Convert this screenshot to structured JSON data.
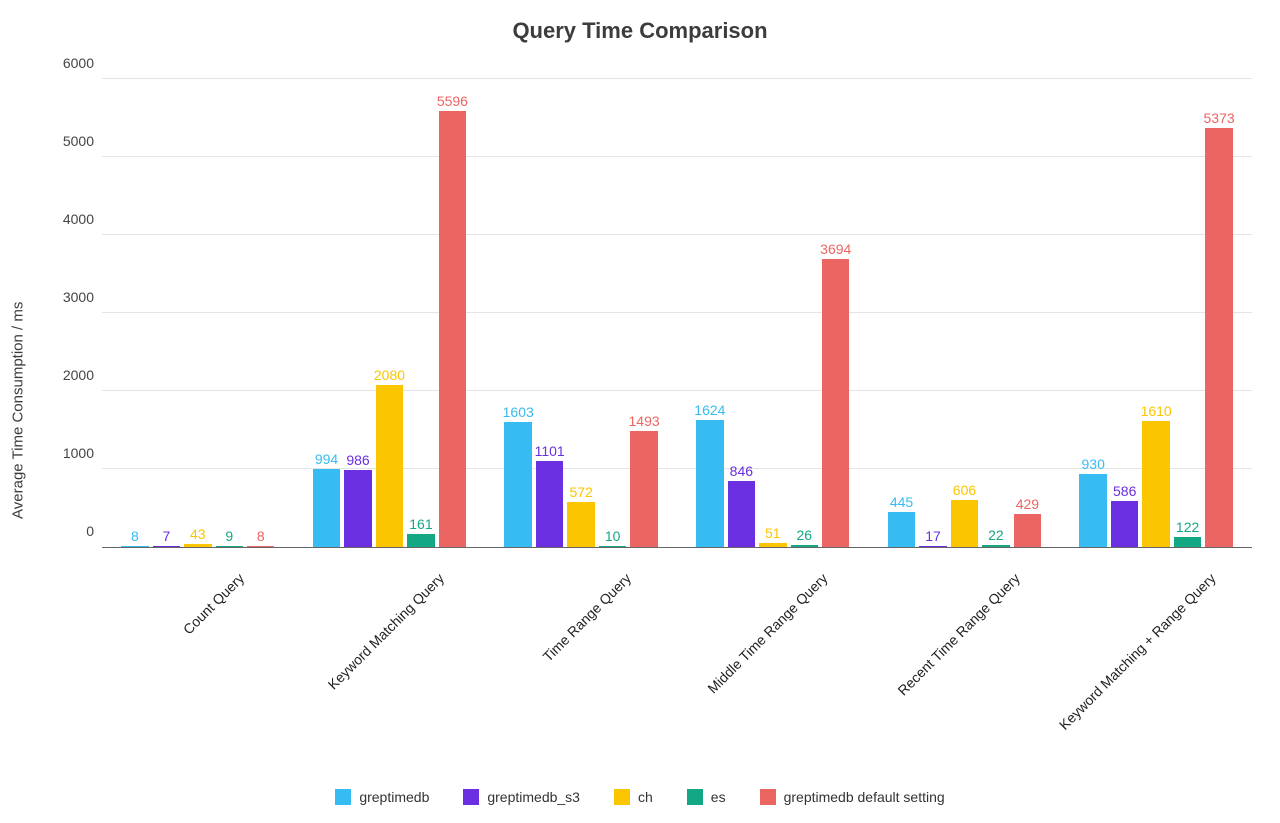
{
  "chart_data": {
    "type": "bar",
    "title": "Query Time Comparison",
    "xlabel": "",
    "ylabel": "Average Time Consumption / ms",
    "ylim": [
      0,
      6000
    ],
    "yticks": [
      0,
      1000,
      2000,
      3000,
      4000,
      5000,
      6000
    ],
    "categories": [
      "Count Query",
      "Keyword Matching Query",
      "Time Range Query",
      "Middle Time Range Query",
      "Recent Time Range Query",
      "Keyword Matching + Range Query"
    ],
    "series": [
      {
        "name": "greptimedb",
        "color": "#36bcf2",
        "values": [
          8,
          994,
          1603,
          1624,
          445,
          930
        ]
      },
      {
        "name": "greptimedb_s3",
        "color": "#6a2fe0",
        "values": [
          7,
          986,
          1101,
          846,
          17,
          586
        ]
      },
      {
        "name": "ch",
        "color": "#fbc500",
        "values": [
          43,
          2080,
          572,
          51,
          606,
          1610
        ]
      },
      {
        "name": "es",
        "color": "#14a784",
        "values": [
          9,
          161,
          10,
          26,
          22,
          122
        ]
      },
      {
        "name": "greptimedb default setting",
        "color": "#eb6562",
        "values": [
          8,
          5596,
          1493,
          3694,
          429,
          5373
        ]
      }
    ]
  }
}
